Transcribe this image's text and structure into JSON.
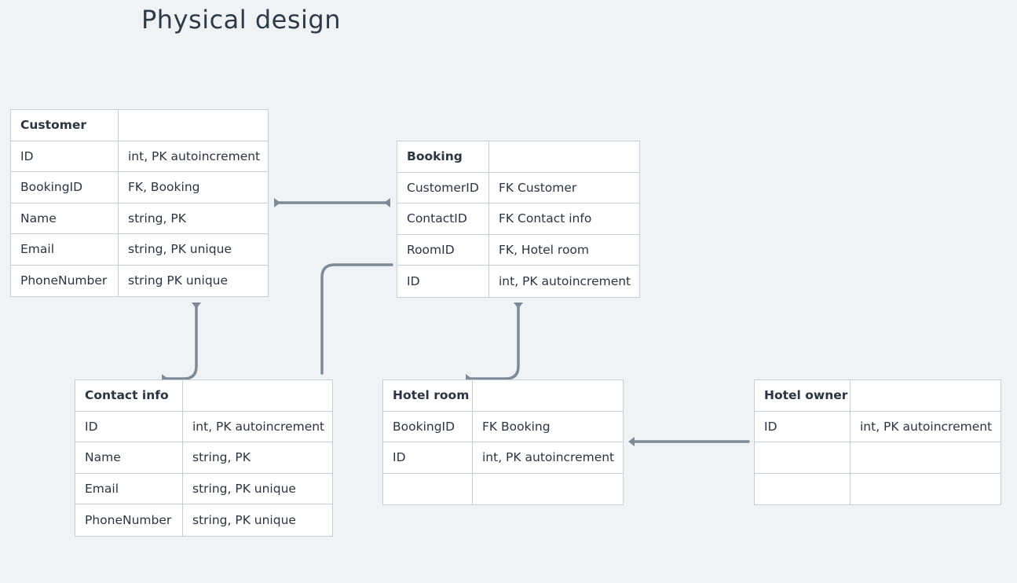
{
  "title": "Physical design",
  "entities": {
    "customer": {
      "name": "Customer",
      "rows": [
        [
          "ID",
          "int, PK autoincrement"
        ],
        [
          "BookingID",
          "FK, Booking"
        ],
        [
          "Name",
          "string, PK"
        ],
        [
          "Email",
          "string, PK unique"
        ],
        [
          "PhoneNumber",
          "string PK unique"
        ]
      ]
    },
    "booking": {
      "name": "Booking",
      "rows": [
        [
          "CustomerID",
          "FK Customer"
        ],
        [
          "ContactID",
          "FK Contact info"
        ],
        [
          "RoomID",
          "FK, Hotel room"
        ],
        [
          "ID",
          "int, PK autoincrement"
        ]
      ]
    },
    "contact": {
      "name": "Contact info",
      "rows": [
        [
          "ID",
          "int, PK autoincrement"
        ],
        [
          "Name",
          "string, PK"
        ],
        [
          "Email",
          "string, PK unique"
        ],
        [
          "PhoneNumber",
          "string, PK unique"
        ]
      ]
    },
    "hotelroom": {
      "name": "Hotel room",
      "rows": [
        [
          "BookingID",
          "FK Booking"
        ],
        [
          "ID",
          "int, PK autoincrement"
        ],
        [
          "",
          ""
        ]
      ]
    },
    "hotelowner": {
      "name": "Hotel owner",
      "rows": [
        [
          "ID",
          "int, PK autoincrement"
        ],
        [
          "",
          ""
        ],
        [
          "",
          ""
        ]
      ]
    }
  },
  "colors": {
    "background": "#f0f3f6",
    "connector": "#7d8a98",
    "border": "#c6cfd9"
  }
}
